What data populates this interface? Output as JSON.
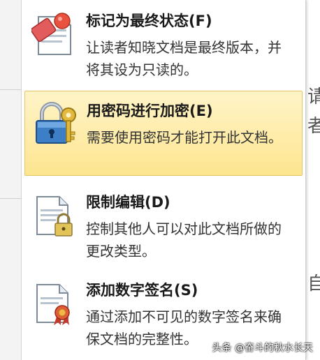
{
  "menu": {
    "items": [
      {
        "title": "标记为最终状态(F)",
        "description": "让读者知晓文档是最终版本，并将其设为只读的。",
        "icon": "mark-final-icon"
      },
      {
        "title": "用密码进行加密(E)",
        "description": "需要使用密码才能打开此文档。",
        "icon": "lock-key-icon",
        "highlighted": true
      },
      {
        "title": "限制编辑(D)",
        "description": "控制其他人可以对此文档所做的更改类型。",
        "icon": "restrict-editing-icon"
      },
      {
        "title": "添加数字签名(S)",
        "description": "通过添加不可见的数字签名来确保文档的完整性。",
        "icon": "digital-signature-icon"
      }
    ]
  },
  "background_text": {
    "char1": "请",
    "char2": "者",
    "char3": "自"
  },
  "watermark": "头条 @奋斗的秋水长天",
  "colors": {
    "highlight_top": "#fff4c8",
    "highlight_bottom": "#fde58f",
    "highlight_border": "#e7c465"
  }
}
